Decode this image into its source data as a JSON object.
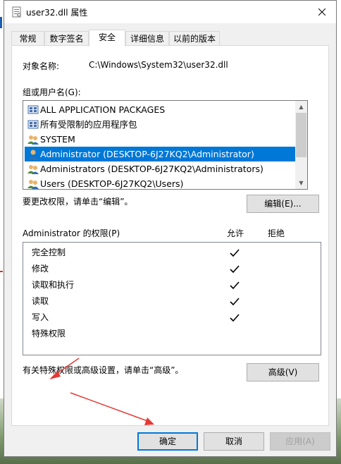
{
  "window": {
    "title": "user32.dll 属性"
  },
  "tabs": [
    {
      "label": "常规",
      "active": false
    },
    {
      "label": "数字签名",
      "active": false
    },
    {
      "label": "安全",
      "active": true
    },
    {
      "label": "详细信息",
      "active": false
    },
    {
      "label": "以前的版本",
      "active": false
    }
  ],
  "security": {
    "object_name_label": "对象名称:",
    "object_name_value": "C:\\Windows\\System32\\user32.dll",
    "group_label": "组或用户名(G):",
    "users": [
      {
        "name": "ALL APPLICATION PACKAGES",
        "icon": "app-package-icon",
        "selected": false
      },
      {
        "name": "所有受限制的应用程序包",
        "icon": "app-package-icon",
        "selected": false
      },
      {
        "name": "SYSTEM",
        "icon": "user-group-icon",
        "selected": false
      },
      {
        "name": "Administrator (DESKTOP-6J27KQ2\\Administrator)",
        "icon": "user-icon",
        "selected": true
      },
      {
        "name": "Administrators (DESKTOP-6J27KQ2\\Administrators)",
        "icon": "user-group-icon",
        "selected": false
      },
      {
        "name": "Users (DESKTOP-6J27KQ2\\Users)",
        "icon": "user-group-icon",
        "selected": false
      }
    ],
    "change_hint": "要更改权限，请单击“编辑”。",
    "edit_button": "编辑(E)...",
    "perm_header": "Administrator 的权限(P)",
    "allow_header": "允许",
    "deny_header": "拒绝",
    "permissions": [
      {
        "name": "完全控制",
        "allow": true,
        "deny": false
      },
      {
        "name": "修改",
        "allow": true,
        "deny": false
      },
      {
        "name": "读取和执行",
        "allow": true,
        "deny": false
      },
      {
        "name": "读取",
        "allow": true,
        "deny": false
      },
      {
        "name": "写入",
        "allow": true,
        "deny": false
      },
      {
        "name": "特殊权限",
        "allow": false,
        "deny": false
      }
    ],
    "advanced_hint": "有关特殊权限或高级设置，请单击“高级”。",
    "advanced_button": "高级(V)"
  },
  "footer": {
    "ok": "确定",
    "cancel": "取消",
    "apply": "应用(A)"
  },
  "colors": {
    "selection": "#0078d7",
    "annotation_arrow": "#e53935"
  }
}
